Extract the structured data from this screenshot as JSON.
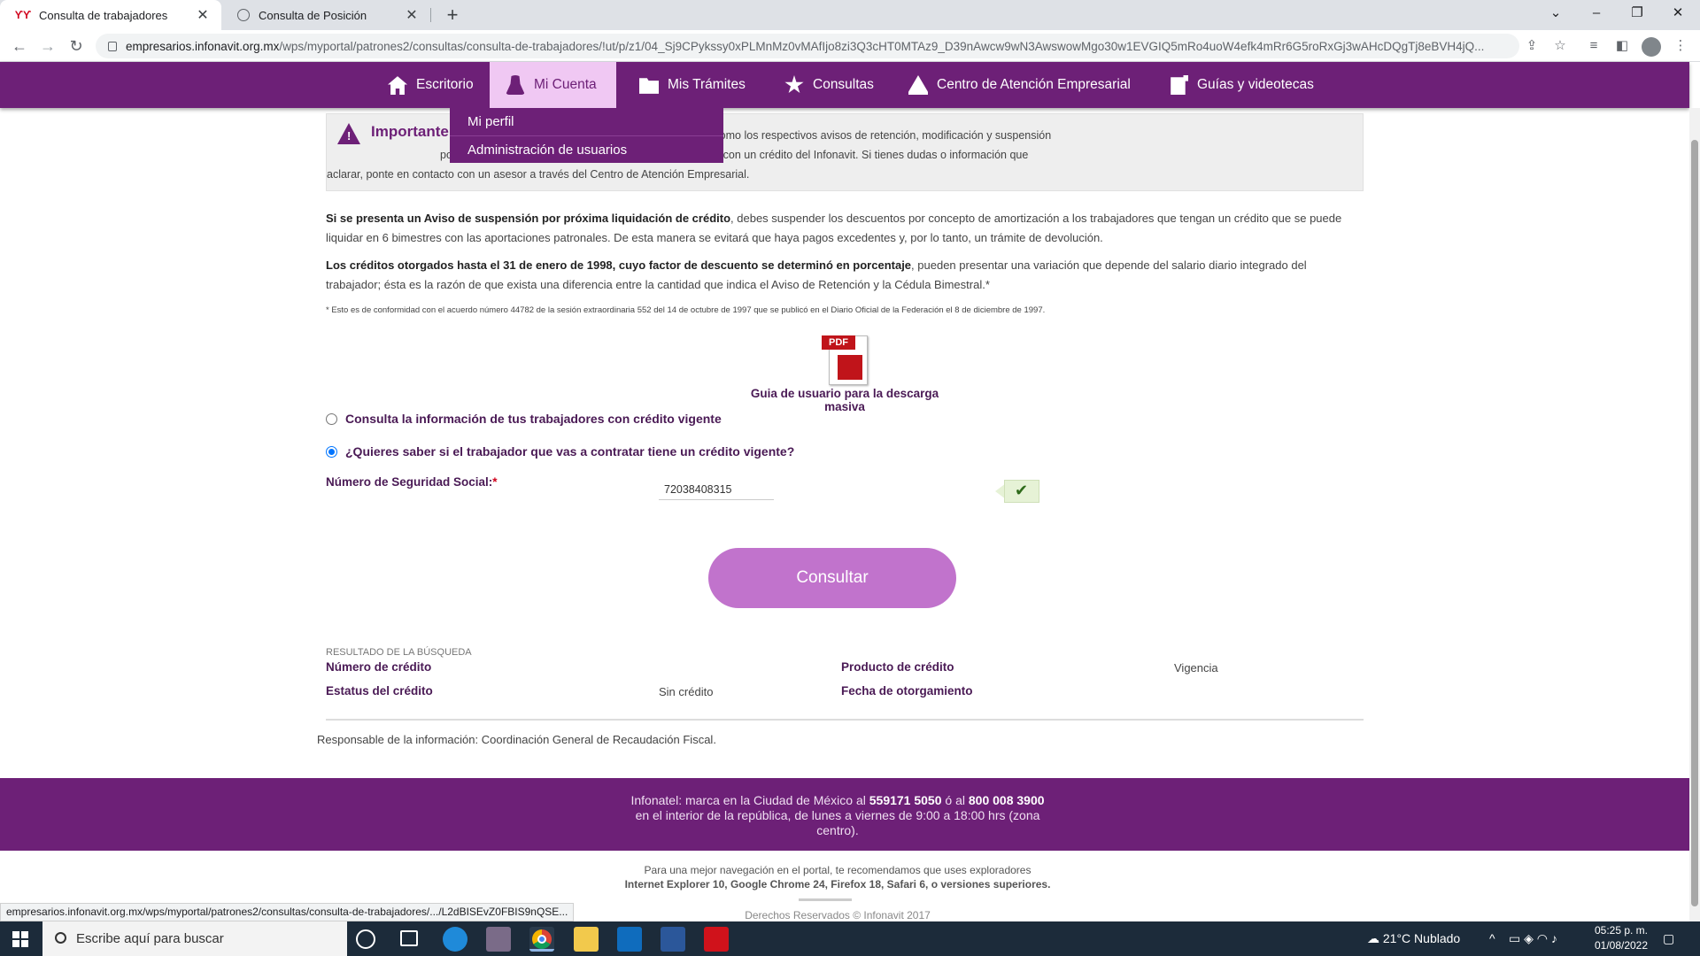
{
  "browser": {
    "tabs": [
      {
        "title": "Consulta de trabajadores",
        "favicon": "infonavit-logo-icon",
        "active": true
      },
      {
        "title": "Consulta de Posición",
        "favicon": "globe-icon",
        "active": false
      }
    ],
    "url_domain": "empresarios.infonavit.org.mx",
    "url_path": "/wps/myportal/patrones2/consultas/consulta-de-trabajadores/!ut/p/z1/04_Sj9CPykssy0xPLMnMz0vMAfIjo8zi3Q3cHT0MTAz9_D39nAwcw9wN3AwswowMgo30w1EVGIQ5mRo4uoW4efk4mRr6G5roRxGj3wAHcDQgTj8eBVH4jQ...",
    "status_url": "empresarios.infonavit.org.mx/wps/myportal/patrones2/consultas/consulta-de-trabajadores/.../L2dBISEvZ0FBIS9nQSE..."
  },
  "nav": {
    "items": [
      {
        "label": "Escritorio",
        "icon": "home-icon"
      },
      {
        "label": "Mi Cuenta",
        "icon": "user-icon"
      },
      {
        "label": "Mis Trámites",
        "icon": "folder-icon"
      },
      {
        "label": "Consultas",
        "icon": "stars-icon"
      },
      {
        "label": "Centro de Atención Empresarial",
        "icon": "support-center-icon"
      },
      {
        "label": "Guías y videotecas",
        "icon": "guide-icon"
      }
    ],
    "dropdown": [
      "Mi perfil",
      "Administración de usuarios"
    ]
  },
  "importante": {
    "title": "Importante",
    "line1": "jadores que han obtenido un crédito del Infonavit, así como los respectivos avisos de retención, modificación y suspensión",
    "line2": "por trabajadores que no tienen relación laboral y cuentan con un crédito del Infonavit. Si tienes dudas o información que",
    "line3": "aclarar, ponte en contacto con un asesor a través del Centro de Atención Empresarial."
  },
  "paragraphs": {
    "p1_bold": "Si se presenta un Aviso de suspensión por próxima liquidación de crédito",
    "p1_rest": ", debes suspender los descuentos por concepto de amortización a los trabajadores que tengan un crédito que se puede liquidar en 6 bimestres con las aportaciones patronales. De esta manera se evitará que haya pagos excedentes y, por lo tanto, un trámite de devolución.",
    "p2_bold": "Los créditos otorgados hasta el 31 de enero de 1998, cuyo factor de descuento se determinó en porcentaje",
    "p2_rest": ", pueden presentar una variación que depende del salario diario integrado del trabajador; ésta es la razón de que exista una diferencia entre la cantidad que indica el Aviso de Retención y la Cédula Bimestral.*",
    "footnote": "* Esto es de conformidad con el acuerdo número 44782 de la sesión extraordinaria 552 del 14 de octubre de 1997 que se publicó en el Diario Oficial de la Federación el 8 de diciembre de 1997."
  },
  "pdf": {
    "badge": "PDF",
    "link": "Guia de usuario para la descarga masiva"
  },
  "form": {
    "option1": "Consulta la información de tus trabajadores con crédito vigente",
    "option2": "¿Quieres saber si el trabajador que vas a contratar tiene un crédito vigente?",
    "selected_option": 2,
    "nss_label": "Número de Seguridad Social:",
    "nss_required": "*",
    "nss_value": "72038408315",
    "submit": "Consultar"
  },
  "result": {
    "heading": "RESULTADO DE LA BÚSQUEDA",
    "numero_credito_label": "Número de crédito",
    "producto_label": "Producto de crédito",
    "vigencia_label": "Vigencia",
    "estatus_label": "Estatus del crédito",
    "estatus_value": "Sin crédito",
    "fecha_label": "Fecha de otorgamiento"
  },
  "responsable": "Responsable de la información: Coordinación General de Recaudación Fiscal.",
  "footer": {
    "line1_pre": "Infonatel: marca en la Ciudad de México al ",
    "phone1": "559171 5050",
    "line1_mid": " ó al ",
    "phone2": "800 008 3900",
    "line2": "en el interior de la república, de lunes a viernes de 9:00 a 18:00 hrs (zona",
    "line3": "centro).",
    "browsers_line1": "Para una mejor navegación en el portal, te recomendamos que uses exploradores",
    "browsers_line2": "Internet Explorer 10, Google Chrome 24, Firefox 18, Safari 6, o versiones superiores.",
    "copyright": "Derechos Reservados © Infonavit 2017"
  },
  "taskbar": {
    "search_placeholder": "Escribe aquí para buscar",
    "weather": "21°C  Nublado",
    "time": "05:25 p. m.",
    "date": "01/08/2022"
  },
  "colors": {
    "brand_purple": "#6d2077",
    "button_purple": "#c173cc",
    "active_nav": "#f0c8f3"
  }
}
